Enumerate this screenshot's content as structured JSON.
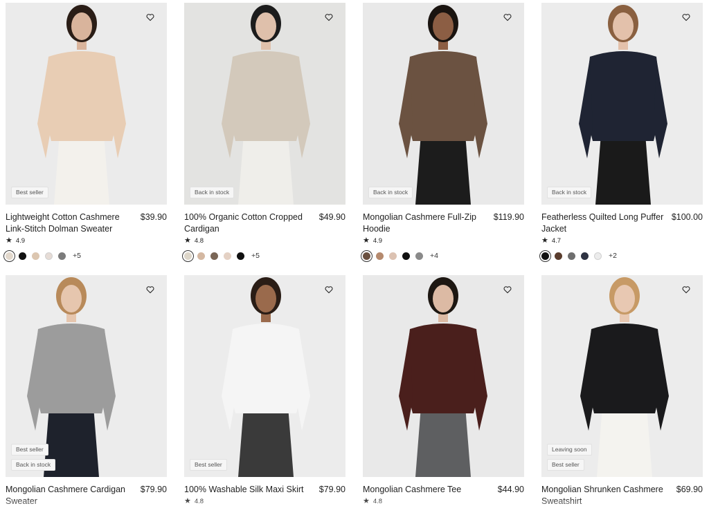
{
  "products": [
    {
      "name": "Lightweight Cotton Cashmere Link-Stitch Dolman Sweater",
      "price": "$39.90",
      "rating": "4.9",
      "badges": [
        "Best seller"
      ],
      "swatches": [
        "#e2d8cc",
        "#111111",
        "#dcc6b0",
        "#e6dcd6",
        "#7c7c7c"
      ],
      "more": "+5",
      "colors": {
        "bg": "#ebebeb",
        "top": "#e8cdb4",
        "bottom": "#f3f1ec",
        "hair": "#2a1d16",
        "skin": "#d9b49c"
      }
    },
    {
      "name": "100% Organic Cotton Cropped Cardigan",
      "price": "$49.90",
      "rating": "4.8",
      "badges": [
        "Back in stock"
      ],
      "swatches": [
        "#ddd6c9",
        "#d4b8a2",
        "#7a6656",
        "#e4d1c4",
        "#111111"
      ],
      "more": "+5",
      "colors": {
        "bg": "#e3e3e1",
        "top": "#d3c9bb",
        "bottom": "#efeeea",
        "hair": "#1c1c1c",
        "skin": "#dfc0ab"
      }
    },
    {
      "name": "Mongolian Cashmere Full-Zip Hoodie",
      "price": "$119.90",
      "rating": "4.9",
      "badges": [
        "Back in stock"
      ],
      "swatches": [
        "#6a5040",
        "#b58a6e",
        "#dcc2b2",
        "#111111",
        "#8a8a8a"
      ],
      "more": "+4",
      "colors": {
        "bg": "#e9e9e9",
        "top": "#6b5241",
        "bottom": "#1c1c1c",
        "hair": "#1a1410",
        "skin": "#8c5e44"
      }
    },
    {
      "name": "Featherless Quilted Long Puffer Jacket",
      "price": "$100.00",
      "rating": "4.7",
      "badges": [
        "Back in stock"
      ],
      "swatches": [
        "#111111",
        "#5a3d2e",
        "#6e6e6e",
        "#2e3342",
        "#ececec"
      ],
      "more": "+2",
      "colors": {
        "bg": "#ececec",
        "top": "#1f2433",
        "bottom": "#1a1a1a",
        "hair": "#8a6040",
        "skin": "#e3c1ab"
      }
    },
    {
      "name": "Mongolian Cashmere Cardigan Sweater",
      "price": "$79.90",
      "rating": "",
      "badges": [
        "Best seller",
        "Back in stock"
      ],
      "swatches": [],
      "more": "",
      "colors": {
        "bg": "#ececec",
        "top": "#9c9c9c",
        "bottom": "#1e222c",
        "hair": "#b88a5a",
        "skin": "#e6c6ae"
      }
    },
    {
      "name": "100% Washable Silk Maxi Skirt",
      "price": "$79.90",
      "rating": "4.8",
      "badges": [
        "Best seller"
      ],
      "swatches": [],
      "more": "",
      "colors": {
        "bg": "#ececec",
        "top": "#f5f5f5",
        "bottom": "#3a3a3a",
        "hair": "#2a1d16",
        "skin": "#9a6a4c"
      }
    },
    {
      "name": "Mongolian Cashmere Tee",
      "price": "$44.90",
      "rating": "4.8",
      "badges": [],
      "swatches": [],
      "more": "",
      "colors": {
        "bg": "#e9e9e9",
        "top": "#4a1f1c",
        "bottom": "#5e5f61",
        "hair": "#1d1712",
        "skin": "#dcbaa4"
      }
    },
    {
      "name": "Mongolian Shrunken Cashmere Sweatshirt",
      "price": "$69.90",
      "rating": "",
      "badges": [
        "Leaving soon",
        "Best seller"
      ],
      "swatches": [],
      "more": "",
      "colors": {
        "bg": "#ececec",
        "top": "#1a1a1c",
        "bottom": "#f4f3ef",
        "hair": "#c79a66",
        "skin": "#e8c8b2"
      }
    }
  ]
}
